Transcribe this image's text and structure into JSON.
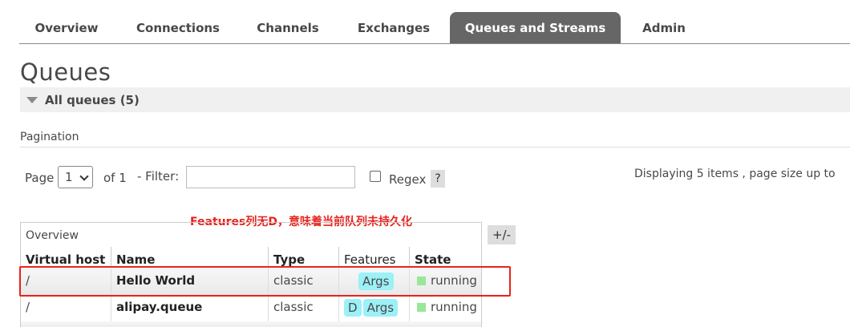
{
  "nav": {
    "tabs": [
      {
        "label": "Overview"
      },
      {
        "label": "Connections"
      },
      {
        "label": "Channels"
      },
      {
        "label": "Exchanges"
      },
      {
        "label": "Queues and Streams",
        "active": true
      },
      {
        "label": "Admin"
      }
    ]
  },
  "page_title": "Queues",
  "section": {
    "title": "All queues (5)"
  },
  "pagination": {
    "label": "Pagination",
    "page_label": "Page",
    "page_value": "1",
    "of_label": "of 1",
    "filter_label": "- Filter:",
    "filter_value": "",
    "regex_label": "Regex",
    "help_label": "?",
    "display_info": "Displaying 5 items , page size up to"
  },
  "annotation": "Features列无D，意味着当前队列未持久化",
  "table": {
    "group_label": "Overview",
    "toggle_label": "+/-",
    "headers": [
      "Virtual host",
      "Name",
      "Type",
      "Features",
      "State"
    ],
    "rows": [
      {
        "vhost": "/",
        "name": "Hello World",
        "type": "classic",
        "features": [
          "Args"
        ],
        "state": "running"
      },
      {
        "vhost": "/",
        "name": "alipay.queue",
        "type": "classic",
        "features": [
          "D",
          "Args"
        ],
        "state": "running"
      }
    ]
  },
  "colors": {
    "accent_red": "#e8221c",
    "badge": "#9cf0f8",
    "running": "#98e898",
    "active_tab": "#666666"
  }
}
